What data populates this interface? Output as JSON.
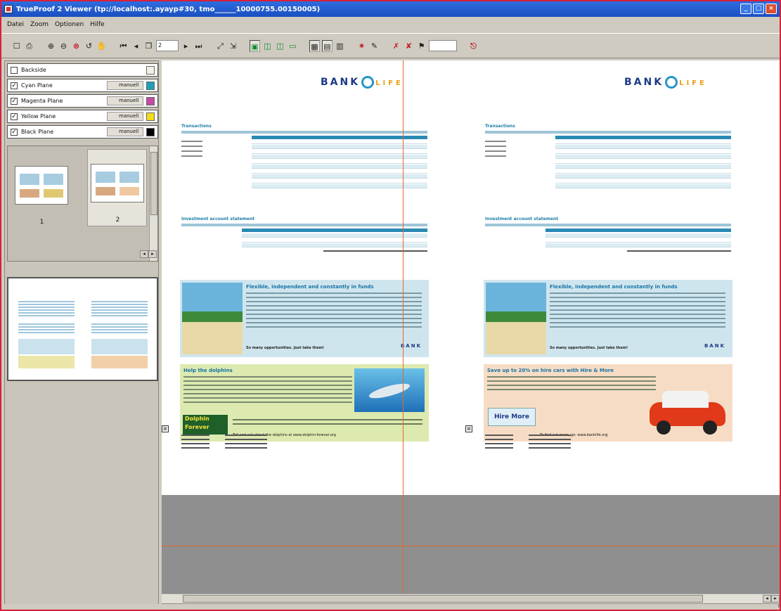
{
  "window": {
    "title": "TrueProof 2 Viewer (tp://localhost:.ayayp#30, tmo______10000755.00150005)",
    "controls": [
      "_",
      "□",
      "×"
    ]
  },
  "menu": [
    "Datei",
    "Zoom",
    "Optionen",
    "Hilfe"
  ],
  "toolbar": {
    "page_value": "2"
  },
  "planes": [
    {
      "name": "Backside",
      "checked": false,
      "mode": "",
      "color": "#f4f0e6"
    },
    {
      "name": "Cyan Plane",
      "checked": true,
      "mode": "manuell",
      "color": "#1fa0b8"
    },
    {
      "name": "Magenta Plane",
      "checked": true,
      "mode": "manuell",
      "color": "#c34aa8"
    },
    {
      "name": "Yellow Plane",
      "checked": true,
      "mode": "manuell",
      "color": "#f3dc1c"
    },
    {
      "name": "Black Plane",
      "checked": true,
      "mode": "manuell",
      "color": "#000000"
    }
  ],
  "thumbnails": [
    {
      "number": "1"
    },
    {
      "number": "2"
    }
  ],
  "pages": [
    {
      "logo_text": "BANK",
      "logo_suffix": "LIFE",
      "section1": "Transactions",
      "section2": "Investment account statement",
      "ad1_title": "Flexible, independent and constantly in funds",
      "ad1_tagline": "So many opportunities. Just take them!",
      "ad1_mini_logo": "BANK",
      "ad2_title": "Help the dolphins",
      "ad2_badge_line1": "Dolphin",
      "ad2_badge_line2": "Forever",
      "ad2_url": "Tell and ask about the dolphins at www.dolphin-forever.org"
    },
    {
      "logo_text": "BANK",
      "logo_suffix": "LIFE",
      "section1": "Transactions",
      "section2": "Investment account statement",
      "ad1_title": "Flexible, independent and constantly in funds",
      "ad1_tagline": "So many opportunities. Just take them!",
      "ad1_mini_logo": "BANK",
      "ad2_title": "Save up to 20% on hire cars with Hire & More",
      "ad2_badge": "Hire More",
      "ad2_url": "To find out more, go: www.banklife.org"
    }
  ]
}
